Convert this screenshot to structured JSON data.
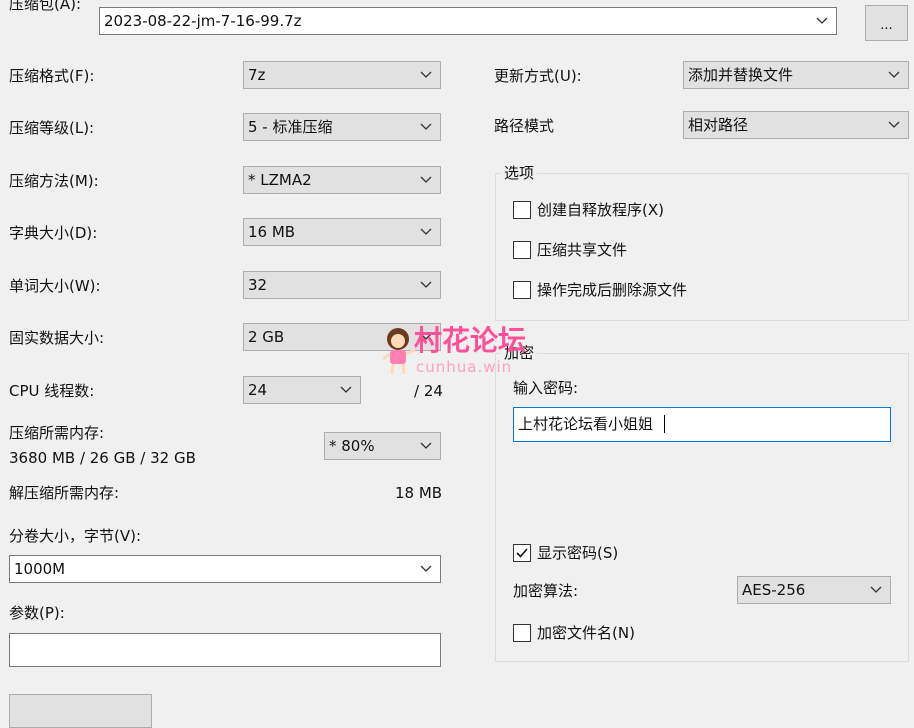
{
  "archive": {
    "label": "压缩包(A):",
    "value": "2023-08-22-jm-7-16-99.7z",
    "browse": "..."
  },
  "left": {
    "format": {
      "label": "压缩格式(F):",
      "value": "7z"
    },
    "level": {
      "label": "压缩等级(L):",
      "value": "5 - 标准压缩"
    },
    "method": {
      "label": "压缩方法(M):",
      "value": "*  LZMA2"
    },
    "dict": {
      "label": "字典大小(D):",
      "value": "16 MB"
    },
    "word": {
      "label": "单词大小(W):",
      "value": "32"
    },
    "solid": {
      "label": "固实数据大小:",
      "value": "2 GB"
    },
    "threads": {
      "label": "CPU 线程数:",
      "value": "24",
      "max": "/ 24"
    },
    "mem_compress": {
      "label": "压缩所需内存:",
      "detail": "3680 MB / 26 GB / 32 GB",
      "value": "*  80%"
    },
    "mem_decompress": {
      "label": "解压缩所需内存:",
      "value": "18 MB"
    },
    "split": {
      "label": "分卷大小，字节(V):",
      "value": "1000M"
    },
    "params": {
      "label": "参数(P):",
      "value": ""
    }
  },
  "right": {
    "update": {
      "label": "更新方式(U):",
      "value": "添加并替换文件"
    },
    "path": {
      "label": "路径模式",
      "value": "相对路径"
    },
    "options": {
      "title": "选项",
      "sfx": "创建自释放程序(X)",
      "shared": "压缩共享文件",
      "delete": "操作完成后删除源文件"
    },
    "encryption": {
      "title": "加密",
      "password_label": "输入密码:",
      "password_value": "上村花论坛看小姐姐",
      "show_password": "显示密码(S)",
      "method_label": "加密算法:",
      "method_value": "AES-256",
      "encrypt_names": "加密文件名(N)"
    }
  },
  "watermark": {
    "text": "村花论坛",
    "sub": "cunhua.win"
  }
}
